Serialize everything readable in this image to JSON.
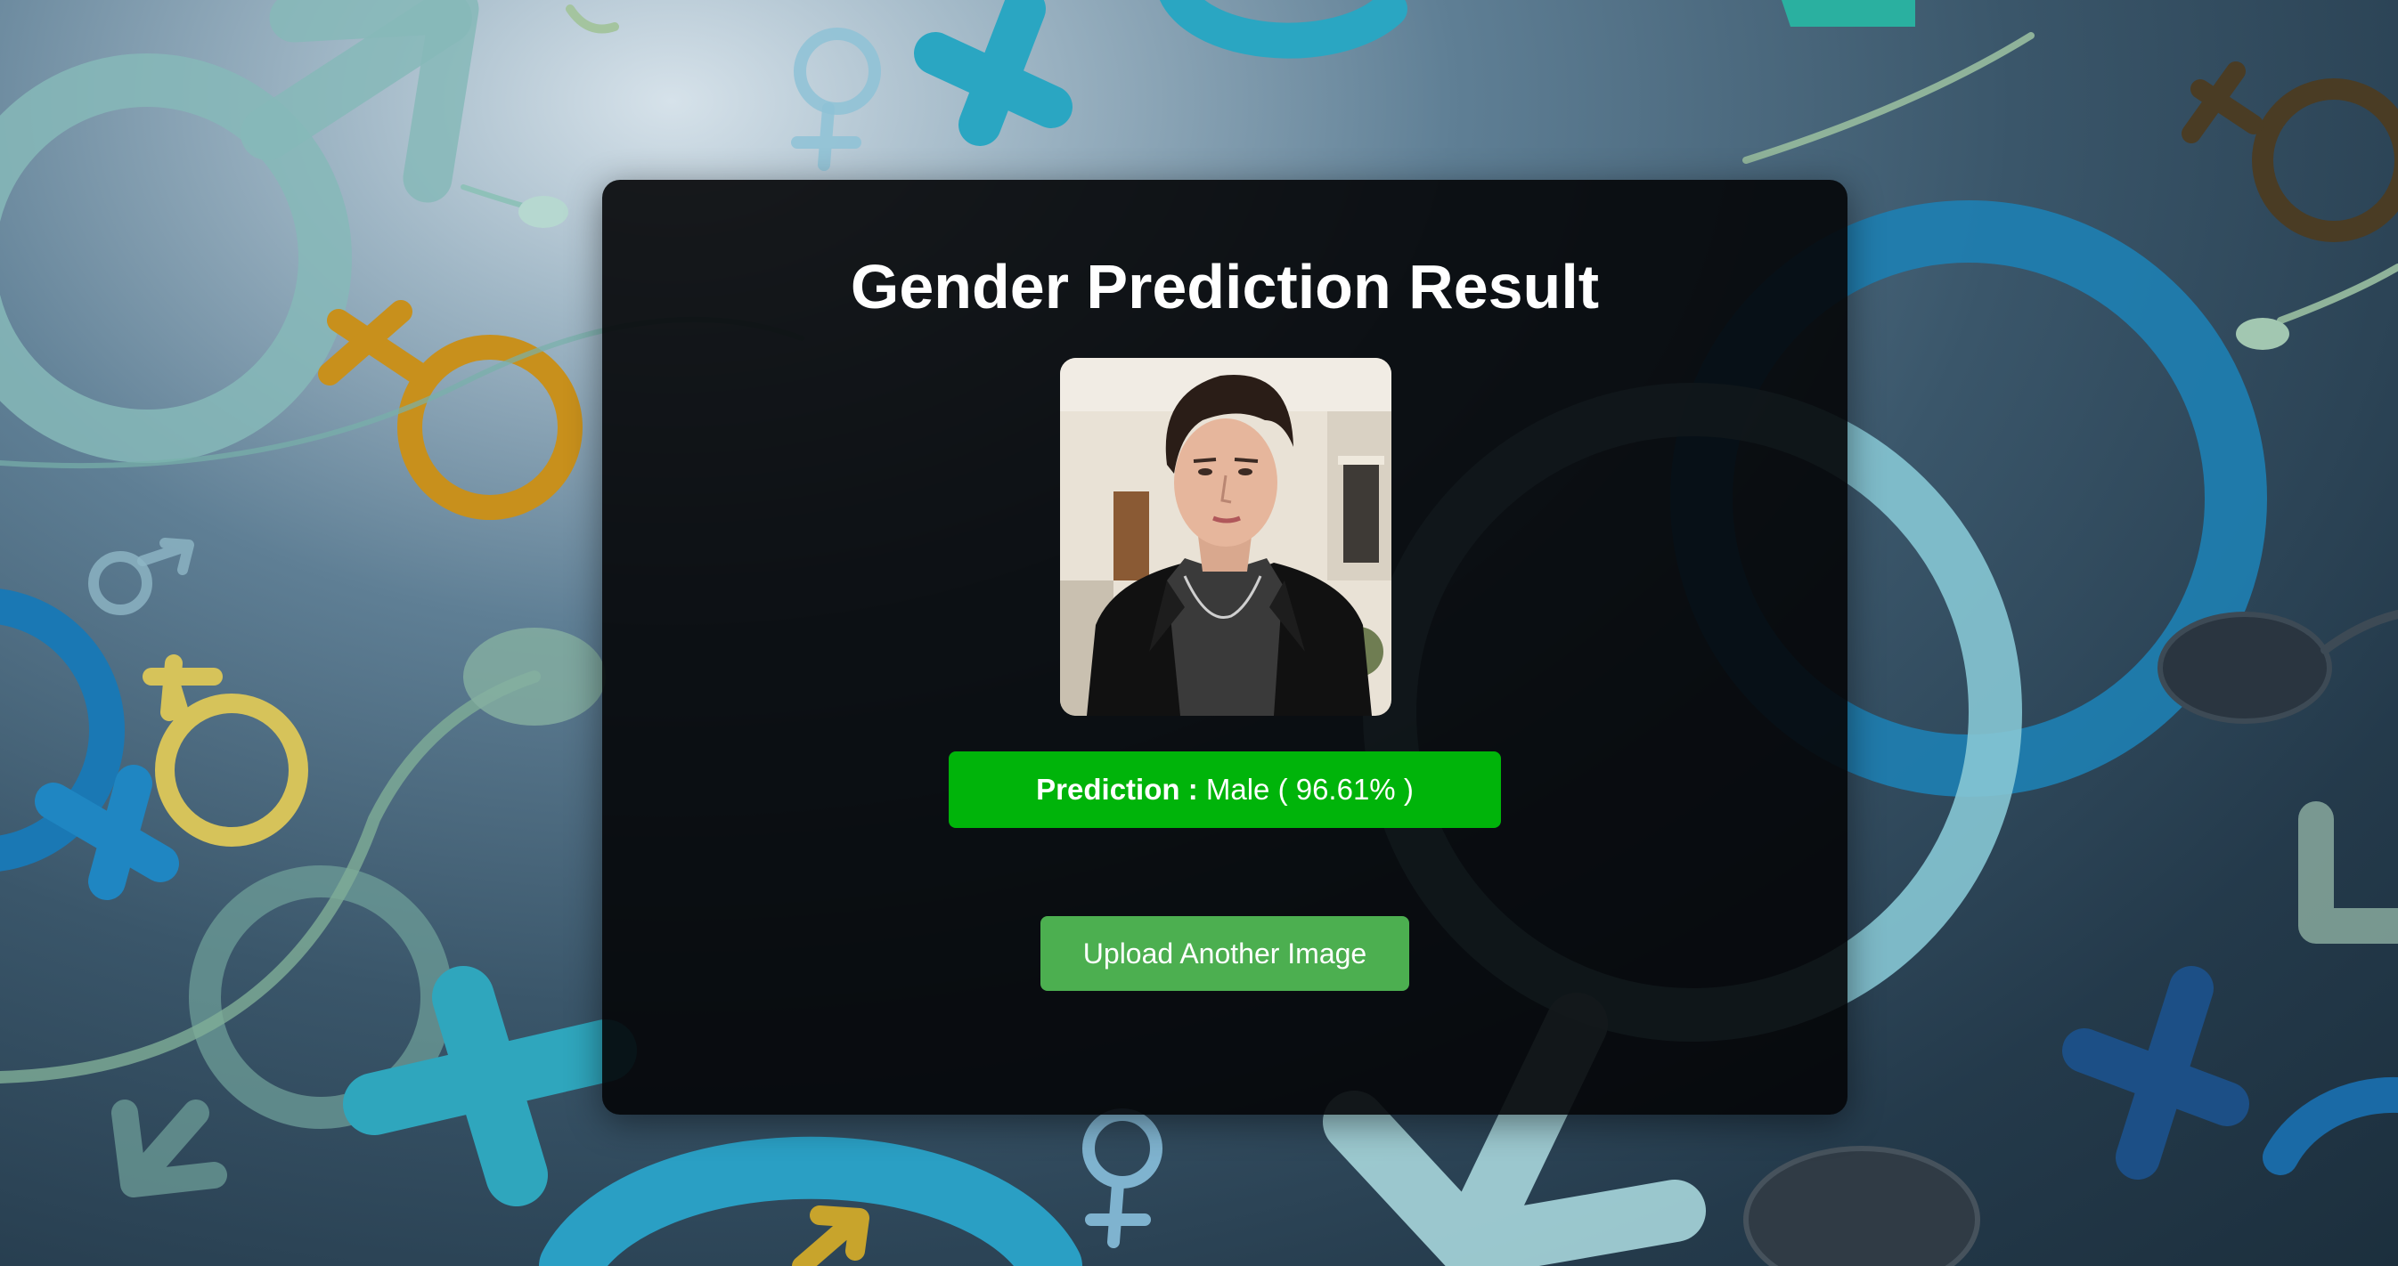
{
  "page": {
    "title": "Gender Prediction Result"
  },
  "result": {
    "prediction_label": "Prediction :",
    "prediction_value": "Male ( 96.61% )",
    "accent_color": "#00b40a"
  },
  "actions": {
    "upload_label": "Upload Another Image",
    "button_color": "#4caf50"
  },
  "icons": {
    "background": [
      "male-symbol",
      "female-symbol",
      "male-female-symbol",
      "sperm-shape"
    ]
  }
}
